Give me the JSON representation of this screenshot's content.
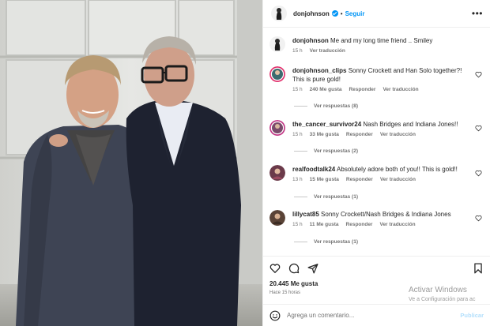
{
  "post": {
    "author": "donjohnson",
    "follow_label": "Seguir",
    "separator": "•",
    "more_icon": "more-horizontal-icon"
  },
  "caption": {
    "username": "donjohnson",
    "text": "Me and my long time friend .. Smiley",
    "time": "15 h",
    "translate": "Ver traducción"
  },
  "comments": [
    {
      "username": "donjohnson_clips",
      "text": "Sonny Crockett and Han Solo together?! This is pure gold!",
      "time": "15 h",
      "likes": "240 Me gusta",
      "reply": "Responder",
      "translate": "Ver traducción",
      "replies": "Ver respuestas (8)"
    },
    {
      "username": "the_cancer_survivor24",
      "text": "Nash Bridges and Indiana Jones!!",
      "time": "15 h",
      "likes": "33 Me gusta",
      "reply": "Responder",
      "translate": "Ver traducción",
      "replies": "Ver respuestas (2)"
    },
    {
      "username": "realfoodtalk24",
      "text": "Absolutely adore both of you!! This is gold!!",
      "time": "13 h",
      "likes": "15 Me gusta",
      "reply": "Responder",
      "translate": "Ver traducción",
      "replies": "Ver respuestas (1)"
    },
    {
      "username": "lillycat85",
      "text": "Sonny Crockett/Nash Bridges & Indiana Jones",
      "time": "15 h",
      "likes": "11 Me gusta",
      "reply": "Responder",
      "translate": "Ver traducción",
      "replies": "Ver respuestas (1)"
    }
  ],
  "actions": {
    "like_icon": "heart-icon",
    "comment_icon": "comment-icon",
    "share_icon": "send-icon",
    "save_icon": "bookmark-icon"
  },
  "likes_count": "20.445 Me gusta",
  "posted_ago": "Hace 15 horas",
  "composer": {
    "placeholder": "Agrega un comentario...",
    "publish_label": "Publicar",
    "emoji_icon": "emoji-icon"
  },
  "watermark": {
    "line1": "Activar Windows",
    "line2": "Ve a Configuración para ac"
  },
  "colors": {
    "accent": "#0095f6",
    "text": "#262626",
    "muted": "#737373",
    "border": "#efefef"
  }
}
